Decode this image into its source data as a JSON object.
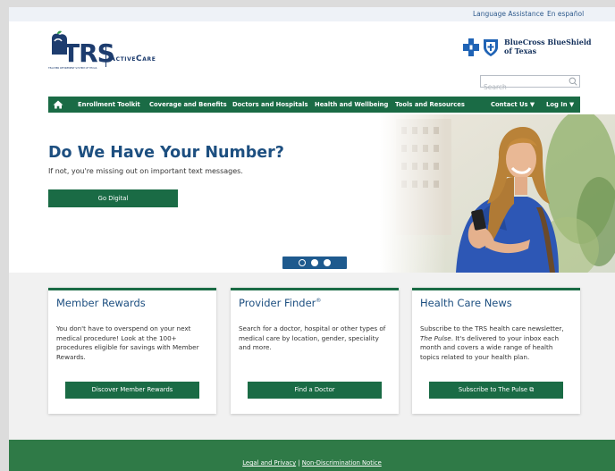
{
  "utility": {
    "language_assistance": "Language Assistance",
    "espanol": "En español"
  },
  "logo": {
    "trs": "TRS",
    "active_care": "ActiveCare",
    "small_text": "TEACHER RETIREMENT SYSTEM OF TEXAS"
  },
  "partner": {
    "line1": "BlueCross BlueShield",
    "line2": "of Texas"
  },
  "search": {
    "placeholder": "Search"
  },
  "nav": {
    "items": [
      {
        "label": "Enrollment Toolkit"
      },
      {
        "label": "Coverage and Benefits"
      },
      {
        "label": "Doctors and Hospitals"
      },
      {
        "label": "Health and Wellbeing"
      },
      {
        "label": "Tools and Resources"
      }
    ],
    "contact": "Contact Us ▼",
    "login": "Log In ▼"
  },
  "hero": {
    "title": "Do We Have Your Number?",
    "subtitle": "If not, you're missing out on important text messages.",
    "button": "Go Digital",
    "carousel_active_index": 0,
    "carousel_count": 3
  },
  "cards": [
    {
      "title": "Member Rewards",
      "body": "You don't have to overspend on your next medical procedure! Look at the 100+ procedures eligible for savings with Member Rewards.",
      "button": "Discover Member Rewards"
    },
    {
      "title": "Provider Finder",
      "title_sup": "®",
      "body": "Search for a doctor, hospital or other types of medical care by location, gender, speciality and more.",
      "button": "Find a Doctor"
    },
    {
      "title": "Health Care News",
      "body_prefix": "Subscribe to the TRS health care newsletter, ",
      "body_em": "The Pulse",
      "body_suffix": ". It's delivered to your inbox each month and covers a wide range of health topics related to your health plan.",
      "button": "Subscribe to The Pulse ⧉"
    }
  ],
  "footer": {
    "legal": "Legal and Privacy",
    "separator": "|",
    "nondiscrimination": "Non-Discrimination Notice"
  },
  "colors": {
    "brand_green": "#1a6b45",
    "brand_blue": "#1d4f80",
    "footer_green": "#2f7a47",
    "carousel_blue": "#1e5a8e"
  }
}
